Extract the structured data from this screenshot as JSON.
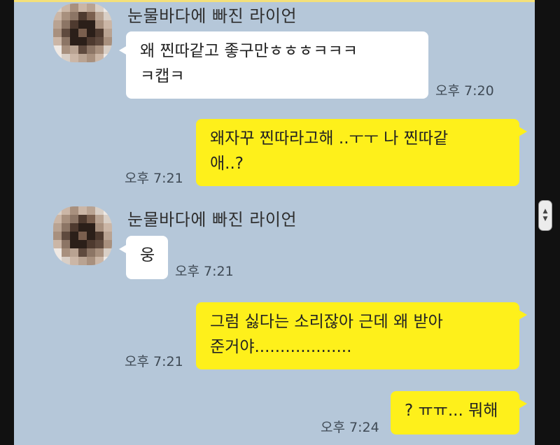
{
  "colors": {
    "chat_background": "#b5c7d9",
    "received_bubble": "#ffffff",
    "sent_bubble": "#fef01b",
    "frame": "#111111"
  },
  "messages": [
    {
      "direction": "received",
      "sender": "눈물바다에 빠진 라이언",
      "text": "왜 찐따같고 좋구만ㅎㅎㅎㅋㅋㅋ\nㅋ캡ㅋ",
      "time": "오후 7:20"
    },
    {
      "direction": "sent",
      "text": "왜자꾸 찐따라고해 ..ㅜㅜ 나 찐따같\n애..?",
      "time": "오후 7:21"
    },
    {
      "direction": "received",
      "sender": "눈물바다에 빠진 라이언",
      "text": "웅",
      "time": "오후 7:21"
    },
    {
      "direction": "sent",
      "text": "그럼 싫다는 소리잖아 근데 왜 받아\n준거야...................",
      "time": "오후 7:21"
    },
    {
      "direction": "sent",
      "text": "? ㅠㅠ... 뭐해",
      "time": "오후 7:24"
    }
  ],
  "scrollbar_icon": "scroll-updown-icon"
}
